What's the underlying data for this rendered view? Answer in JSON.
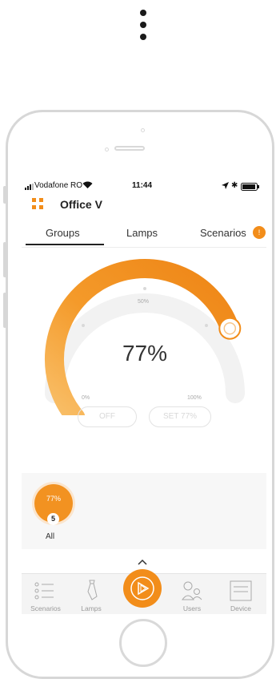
{
  "status_bar": {
    "carrier": "Vodafone RO",
    "time": "11:44"
  },
  "header": {
    "title": "Office V",
    "menu_icon": "grid-icon"
  },
  "tabs": [
    {
      "label": "Groups",
      "active": true
    },
    {
      "label": "Lamps",
      "active": false
    },
    {
      "label": "Scenarios",
      "active": false,
      "badge": "!"
    }
  ],
  "dimmer": {
    "level_label": "77%",
    "level": 77,
    "min_label": "0%",
    "mid_label": "50%",
    "max_label": "100%",
    "accent": "#f28d1a"
  },
  "buttons": {
    "off": "OFF",
    "set": "SET 77%"
  },
  "group": {
    "level_label": "77%",
    "count": "5",
    "name": "All"
  },
  "tabbar": [
    {
      "label": "Scenarios",
      "icon": "list-icon"
    },
    {
      "label": "Lamps",
      "icon": "lamp-icon"
    },
    {
      "label": "",
      "icon": "play-icon"
    },
    {
      "label": "Users",
      "icon": "users-icon"
    },
    {
      "label": "Device",
      "icon": "device-icon"
    }
  ]
}
